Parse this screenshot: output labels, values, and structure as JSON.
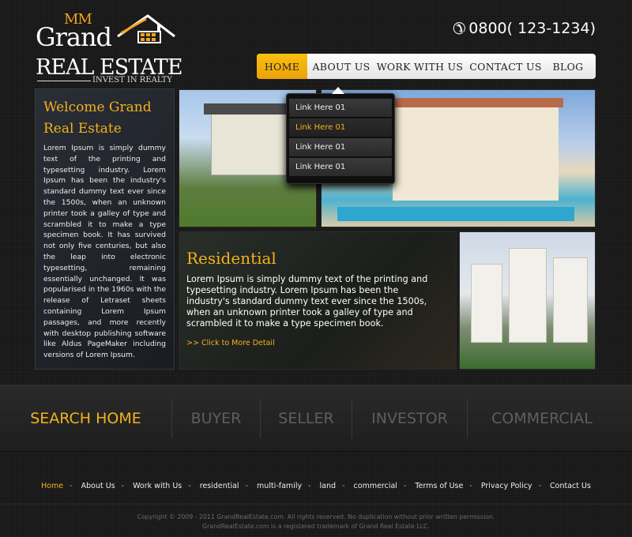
{
  "logo": {
    "mm": "MM",
    "grand": "Grand",
    "real_estate": "REAL ESTATE",
    "tagline": "INVEST IN REALTY"
  },
  "phone": {
    "number": "0800( 123-1234)",
    "icon": "phone-icon"
  },
  "nav": {
    "items": [
      {
        "label": "HOME",
        "active": true
      },
      {
        "label": "ABOUT US",
        "active": false
      },
      {
        "label": "WORK WITH US",
        "active": false
      },
      {
        "label": "CONTACT US",
        "active": false
      },
      {
        "label": "BLOG",
        "active": false
      }
    ]
  },
  "dropdown": {
    "items": [
      {
        "label": "Link Here 01",
        "highlighted": false
      },
      {
        "label": "Link Here 01",
        "highlighted": true
      },
      {
        "label": "Link Here 01",
        "highlighted": false
      },
      {
        "label": "Link Here 01",
        "highlighted": false
      }
    ]
  },
  "welcome": {
    "title_line1": "Welcome Grand",
    "title_line2": "Real Estate",
    "body": "Lorem Ipsum is simply dummy text of the printing and typesetting industry. Lorem Ipsum has been the industry's standard dummy text ever since the 1500s, when an unknown printer took a galley of type and scrambled it to make a type specimen book. It has survived not only five centuries, but also the leap into electronic typesetting, remaining essentially unchanged. It was popularised in the 1960s with the release of Letraset sheets containing Lorem Ipsum passages, and more recently with desktop publishing software like Aldus PageMaker including versions of Lorem Ipsum."
  },
  "residential": {
    "title": "Residential",
    "body": "Lorem Ipsum is simply dummy text of the printing and typesetting industry. Lorem Ipsum has been the industry's standard dummy text ever since the 1500s, when an unknown printer took a galley of type and scrambled it to make a type specimen book.",
    "link": ">> Click to More Detail"
  },
  "search_bar": {
    "items": [
      {
        "label": "SEARCH HOME",
        "active": true
      },
      {
        "label": "BUYER",
        "active": false
      },
      {
        "label": "SELLER",
        "active": false
      },
      {
        "label": "INVESTOR",
        "active": false
      },
      {
        "label": "COMMERCIAL",
        "active": false
      }
    ]
  },
  "footer": {
    "links": [
      "Home",
      "About Us",
      "Work with Us",
      "residential",
      "multi-family",
      "land",
      "commercial",
      "Terms of Use",
      "Privacy Policy",
      "Contact Us"
    ],
    "separator": "-",
    "copyright_line1": "Copyright © 2009 - 2011 GrandRealEstate.com. All rights reserved. No duplication without prior written permission.",
    "copyright_line2": "GrandRealEstate.com is a registered trademark of Grand Real Estate LLC."
  },
  "colors": {
    "accent": "#f2b21c",
    "background": "#171717",
    "muted_nav": "#5e5e5e"
  }
}
